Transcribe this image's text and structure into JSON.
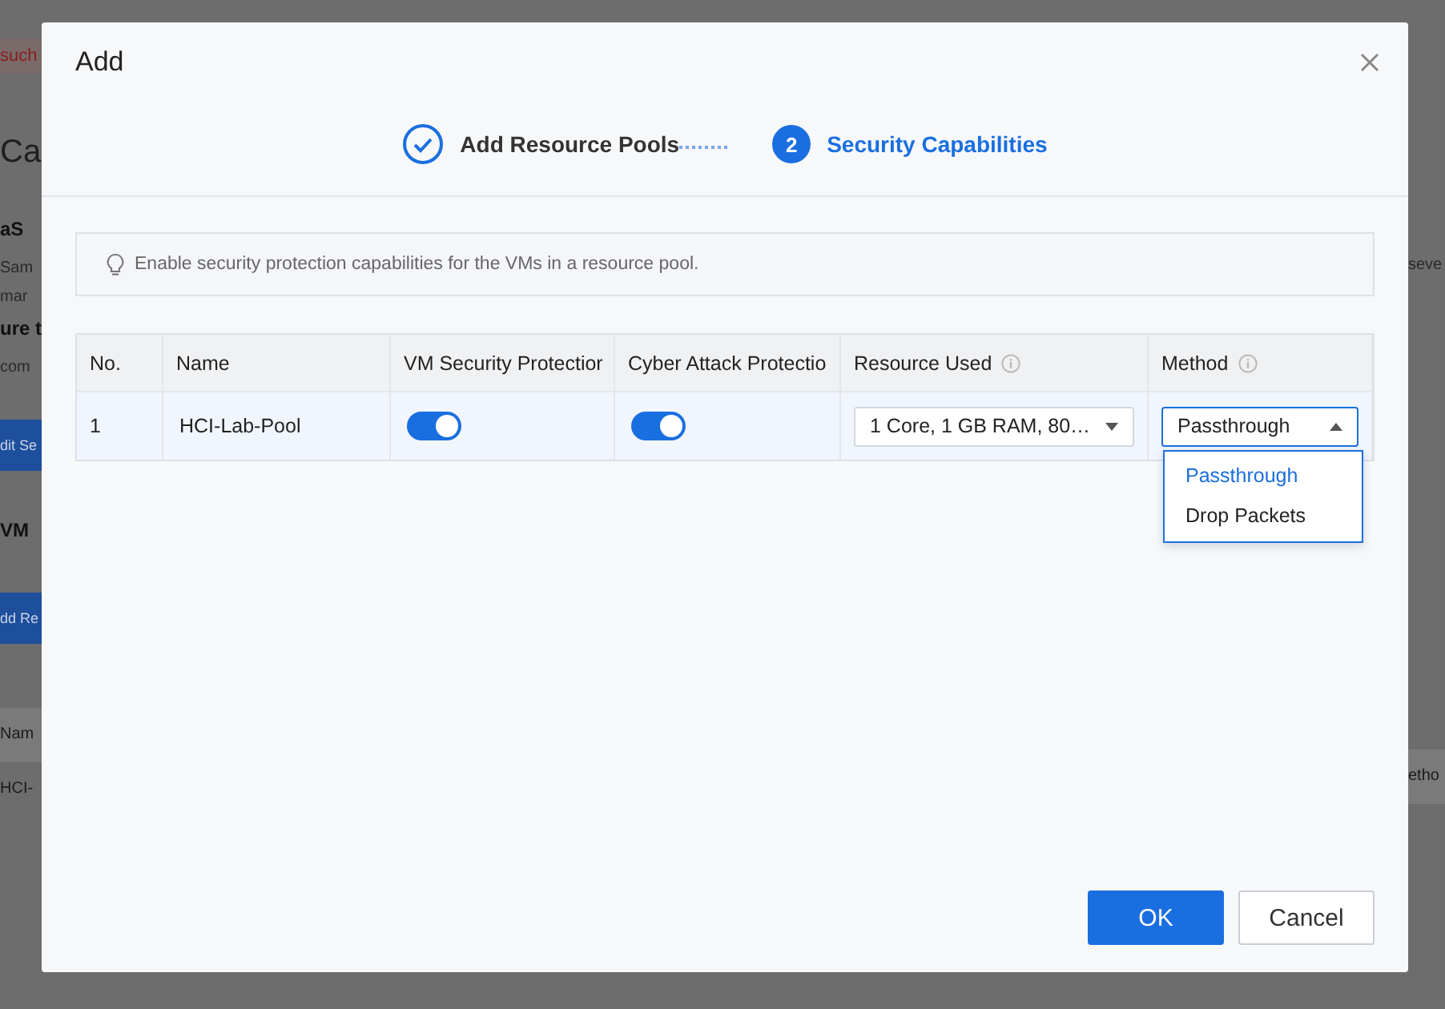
{
  "background": {
    "left_fragments": [
      {
        "kind": "alert",
        "text": "such"
      },
      {
        "kind": "heading",
        "text": "Ca"
      },
      {
        "kind": "subheading",
        "text": "aS"
      },
      {
        "kind": "text",
        "text": "Sam"
      },
      {
        "kind": "text",
        "text": "mar"
      },
      {
        "kind": "subheading",
        "text": "ure t"
      },
      {
        "kind": "text",
        "text": "com"
      },
      {
        "kind": "button",
        "text": "dit Se"
      },
      {
        "kind": "subheading",
        "text": "VM"
      },
      {
        "kind": "button",
        "text": "dd Re"
      },
      {
        "kind": "column_header",
        "text": "Nam"
      },
      {
        "kind": "cell",
        "text": "HCI-"
      }
    ],
    "right_fragments": [
      {
        "kind": "text",
        "text": "seve"
      },
      {
        "kind": "column_header",
        "text": "etho"
      }
    ]
  },
  "dialog": {
    "title": "Add",
    "steps": [
      {
        "label": "Add Resource Pools",
        "completed": true,
        "current": false
      },
      {
        "label": "Security Capabilities",
        "completed": false,
        "current": true,
        "number": "2"
      }
    ],
    "hint": "Enable security protection capabilities for the VMs in a resource pool.",
    "table": {
      "columns": [
        {
          "label": "No."
        },
        {
          "label": "Name"
        },
        {
          "label": "VM Security Protectior"
        },
        {
          "label": "Cyber Attack Protectio"
        },
        {
          "label": "Resource Used",
          "info": true
        },
        {
          "label": "Method",
          "info": true
        }
      ],
      "rows": [
        {
          "no": "1",
          "name": "HCI-Lab-Pool",
          "vm_security_protection": true,
          "cyber_attack_protection": true,
          "resource_used": "1 Core, 1 GB RAM, 80…",
          "method": {
            "value": "Passthrough",
            "expanded": true,
            "options": [
              {
                "label": "Passthrough",
                "selected": true
              },
              {
                "label": "Drop Packets",
                "selected": false
              }
            ]
          }
        }
      ]
    },
    "buttons": [
      {
        "label": "OK",
        "kind": "primary"
      },
      {
        "label": "Cancel",
        "kind": "secondary"
      }
    ]
  }
}
